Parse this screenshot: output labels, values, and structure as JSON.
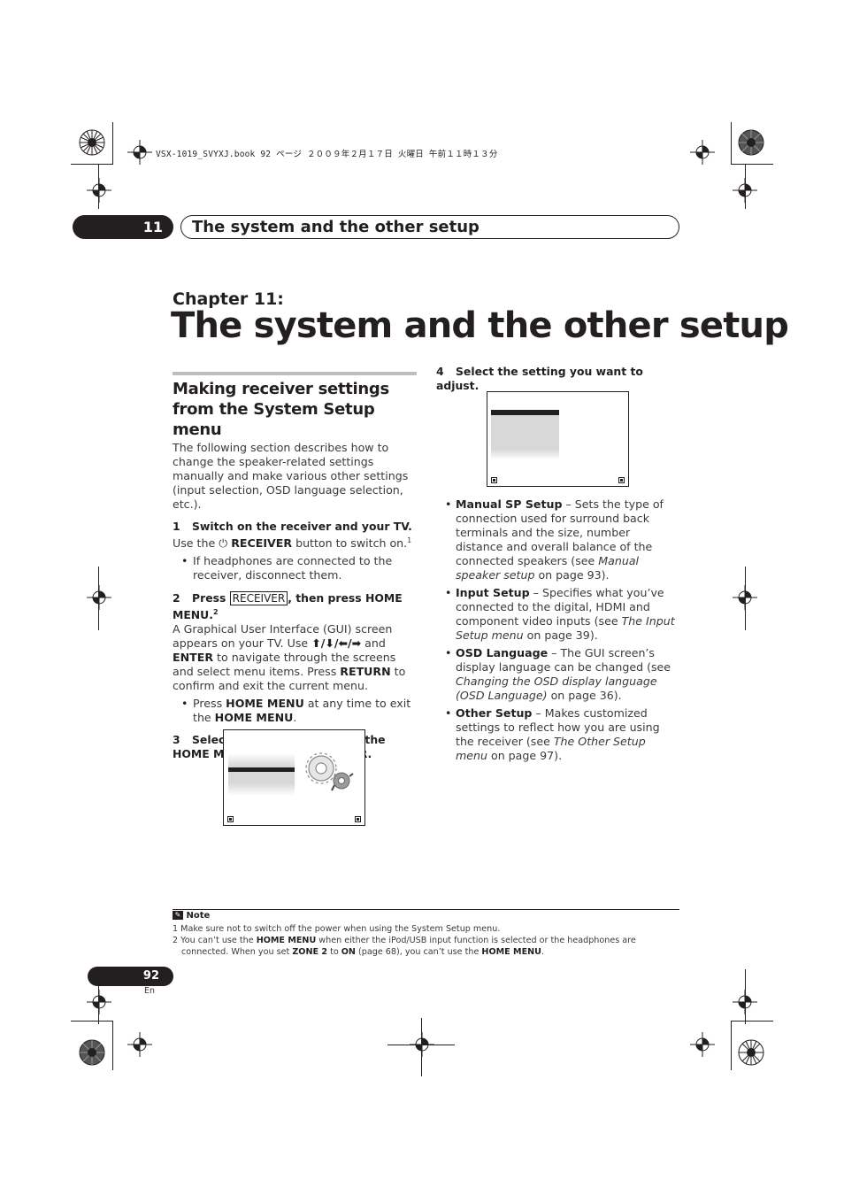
{
  "file_header": "VSX-1019_SVYXJ.book  92 ページ  ２００９年２月１７日  火曜日  午前１１時１３分",
  "chapter_bar": {
    "number": "11",
    "title": "The system and the other setup"
  },
  "chapter_label": "Chapter 11:",
  "chapter_title": "The system and the other setup",
  "left_column": {
    "section_heading": "Making receiver settings from the System Setup menu",
    "intro": "The following section describes how to change the speaker-related settings manually and make various other settings (input selection, OSD language selection, etc.).",
    "step1": {
      "num": "1",
      "label": "Switch on the receiver and your TV."
    },
    "step1_text": {
      "pre": "Use the ",
      "icon": "power-icon",
      "bold": "RECEIVER",
      "post": " button to switch on.",
      "sup": "1"
    },
    "step1_bullet": "If headphones are connected to the receiver, disconnect them.",
    "step2": {
      "num": "2",
      "pre": "Press ",
      "button": "RECEIVER",
      "post": ", then press HOME MENU.",
      "sup": "2"
    },
    "step2_text": {
      "a": "A Graphical User Interface (GUI) screen appears on your TV. Use ",
      "arrows": "⬆/⬇/⬅/➡",
      "b": " and ",
      "enter": "ENTER",
      "c": " to navigate through the screens and select menu items. Press ",
      "return": "RETURN",
      "d": " to confirm and exit the current menu."
    },
    "step2_bullet": {
      "pre": "Press ",
      "bold1": "HOME MENU",
      "mid": " at any time to exit the ",
      "bold2": "HOME MENU",
      "post": "."
    },
    "step3": {
      "num": "3",
      "label": "Select ‘System Setup’ from the HOME MENU, then press ENTER."
    }
  },
  "right_column": {
    "step4": {
      "num": "4",
      "label": "Select the setting you want to adjust."
    },
    "bullets": [
      {
        "bold": "Manual SP Setup",
        "text": " – Sets the type of connection used for surround back terminals and the size, number distance and overall balance of the connected speakers (see ",
        "italic": "Manual speaker setup",
        "post": " on page 93)."
      },
      {
        "bold": "Input Setup",
        "text": " – Specifies what you’ve connected to the digital, HDMI and component video inputs (see ",
        "italic": "The Input Setup menu",
        "post": " on page 39)."
      },
      {
        "bold": "OSD Language",
        "text": " – The GUI screen’s display language can be changed (see ",
        "italic": "Changing the OSD display language (OSD Language)",
        "post": " on page 36)."
      },
      {
        "bold": "Other Setup",
        "text": " – Makes customized settings to reflect how you are using the receiver (see ",
        "italic": "The Other Setup menu",
        "post": " on page 97)."
      }
    ]
  },
  "note": {
    "heading": "Note",
    "footnotes": [
      {
        "num": "1",
        "text": "Make sure not to switch off the power when using the System Setup menu."
      },
      {
        "num": "2",
        "pre": "You can’t use the ",
        "b1": "HOME MENU",
        "mid1": " when either the iPod/USB input function is selected or the headphones are connected. When you set ",
        "b2": "ZONE 2",
        "mid2": " to ",
        "b3": "ON",
        "mid3": " (page 68), you can’t use the ",
        "b4": "HOME MENU",
        "post": "."
      }
    ]
  },
  "page": {
    "number": "92",
    "lang": "En"
  }
}
